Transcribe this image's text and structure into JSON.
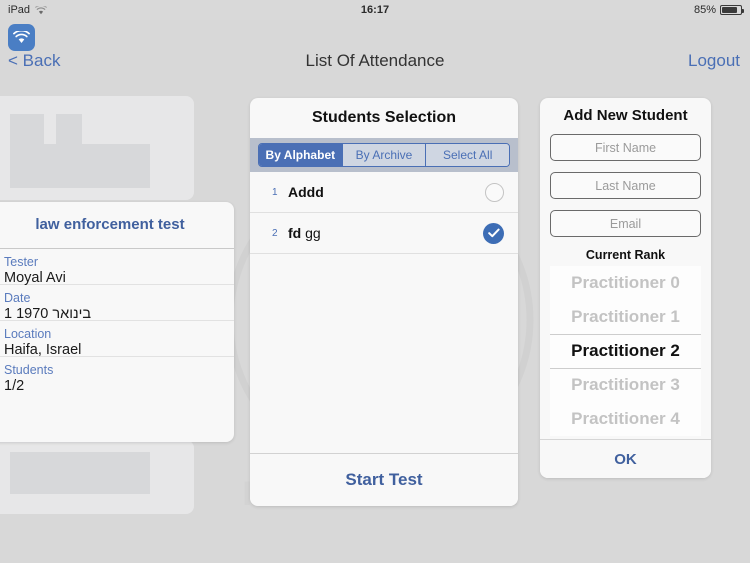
{
  "status_bar": {
    "device": "iPad",
    "wifi_icon": "wifi-icon",
    "time": "16:17",
    "battery_percent": "85%",
    "battery_icon": "battery-icon"
  },
  "app_icon": {
    "name": "wifi-app-icon"
  },
  "nav": {
    "back_label": "< Back",
    "title": "List Of Attendance",
    "logout_label": "Logout"
  },
  "detail_card": {
    "title": "law enforcement test",
    "rows": [
      {
        "label": "Tester",
        "value": "Moyal Avi"
      },
      {
        "label": "Date",
        "value": "1 1970 בינואר"
      },
      {
        "label": "Location",
        "value": "Haifa, Israel"
      },
      {
        "label": "Students",
        "value": "1/2"
      }
    ]
  },
  "students_panel": {
    "title": "Students Selection",
    "segments": [
      {
        "label": "By Alphabet",
        "active": true
      },
      {
        "label": "By Archive",
        "active": false
      },
      {
        "label": "Select All",
        "active": false
      }
    ],
    "rows": [
      {
        "num": "1",
        "first": "Addd",
        "last": "",
        "checked": false
      },
      {
        "num": "2",
        "first": "fd",
        "last": "gg",
        "checked": true
      }
    ],
    "start_button": "Start Test"
  },
  "add_student_panel": {
    "title": "Add New Student",
    "fields": [
      {
        "name": "first-name-field",
        "placeholder": "First Name",
        "value": ""
      },
      {
        "name": "last-name-field",
        "placeholder": "Last Name",
        "value": ""
      },
      {
        "name": "email-field",
        "placeholder": "Email",
        "value": ""
      }
    ],
    "rank_label": "Current Rank",
    "rank_options": [
      {
        "label": "Practitioner 0",
        "selected": false
      },
      {
        "label": "Practitioner 1",
        "selected": false
      },
      {
        "label": "Practitioner 2",
        "selected": true
      },
      {
        "label": "Practitioner 3",
        "selected": false
      },
      {
        "label": "Practitioner 4",
        "selected": false
      }
    ],
    "ok_label": "OK"
  },
  "colors": {
    "accent_blue": "#4a6fb5",
    "title_blue": "#40609e",
    "page_background": "#d8d8d8",
    "card_background": "#f8f8f8",
    "segment_strip": "#b8bfcc",
    "check_blue": "#3d6db5"
  }
}
